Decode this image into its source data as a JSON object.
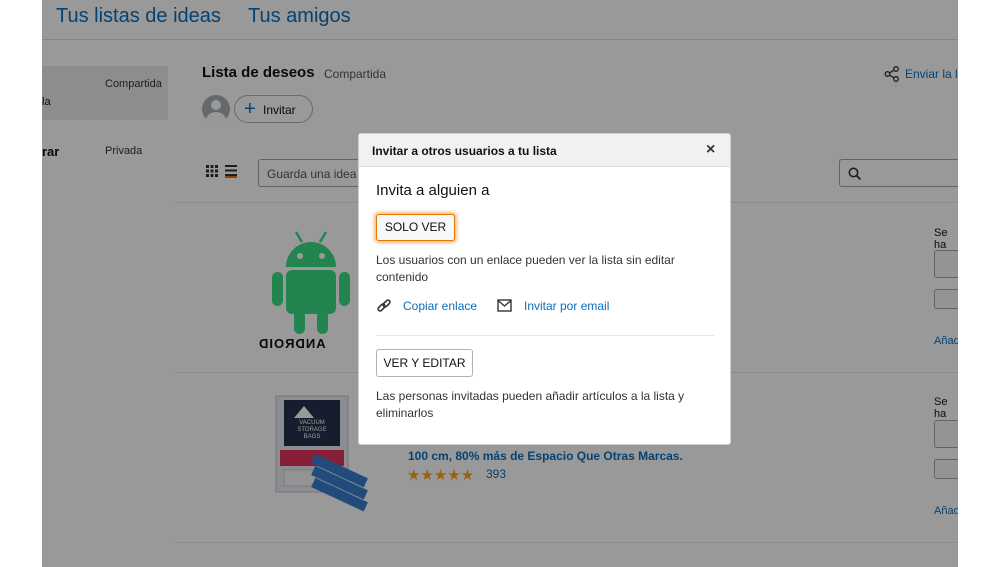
{
  "topnav": {
    "tab_lists": "Tus listas de ideas",
    "tab_friends": "Tus amigos"
  },
  "sidebar": {
    "items": [
      {
        "name": "la",
        "status": "Compartida"
      },
      {
        "name": "rar",
        "status": "Privada"
      }
    ]
  },
  "list": {
    "title": "Lista de deseos",
    "status": "Compartida",
    "invite_label": "Invitar",
    "share_label": "Enviar la l",
    "search_idea_placeholder": "Guarda una idea"
  },
  "products": [
    {
      "image_text": "ANDROID",
      "side_label": "Se ha",
      "side_link": "Añad"
    },
    {
      "image_text": "VACUUM STORAGE BAGS",
      "title": "100 cm, 80% más de Espacio Que Otras Marcas.",
      "stars": "★★★★★",
      "rating_count": "393",
      "side_label": "Se ha",
      "side_link": "Añad"
    }
  ],
  "modal": {
    "title": "Invitar a otros usuarios a tu lista",
    "close": "×",
    "heading": "Invita a alguien a",
    "view_only_label": "SOLO VER",
    "view_only_desc": "Los usuarios con un enlace pueden ver la lista sin editar contenido",
    "copy_link_label": "Copiar enlace",
    "email_invite_label": "Invitar por email",
    "view_edit_label": "VER Y EDITAR",
    "view_edit_desc": "Las personas invitadas pueden añadir artículos a la lista y eliminarlos"
  },
  "colors": {
    "link": "#0a6ebd",
    "accent_orange": "#e77600",
    "star": "#ffa41c",
    "android_green": "#3ddc84"
  }
}
